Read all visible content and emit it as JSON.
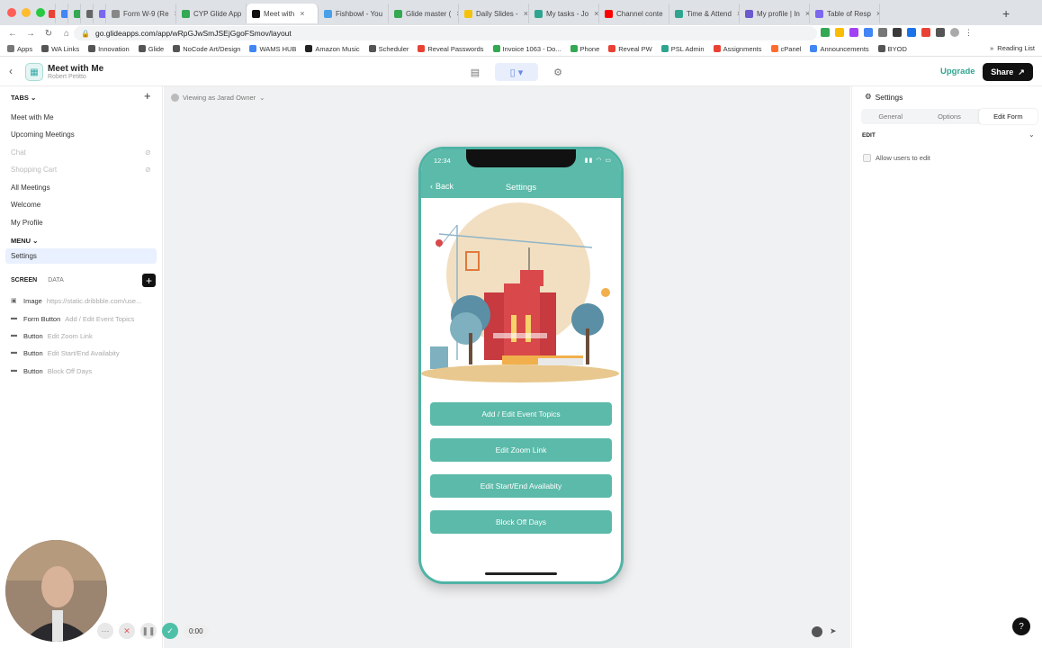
{
  "browser": {
    "tabs": [
      {
        "label": "",
        "color": "#e94235"
      },
      {
        "label": "",
        "color": "#4285f4"
      },
      {
        "label": "",
        "color": "#34a853"
      },
      {
        "label": "",
        "color": "#666666"
      },
      {
        "label": "",
        "color": "#7b68ee"
      },
      {
        "label": "Form W-9 (Re",
        "color": "#888888"
      },
      {
        "label": "CYP Glide App",
        "color": "#34a853"
      },
      {
        "label": "Meet with",
        "color": "#111111",
        "active": true
      },
      {
        "label": "Fishbowl - You",
        "color": "#4a9fe8"
      },
      {
        "label": "Glide master (",
        "color": "#34a853"
      },
      {
        "label": "Daily Slides -",
        "color": "#f4c20d"
      },
      {
        "label": "My tasks - Jo",
        "color": "#2fa58f"
      },
      {
        "label": "Channel conte",
        "color": "#ff0000"
      },
      {
        "label": "Time & Attend",
        "color": "#2fa58f"
      },
      {
        "label": "My profile | In",
        "color": "#6a5acd"
      },
      {
        "label": "Table of Resp",
        "color": "#7b68ee"
      }
    ],
    "url": "go.glideapps.com/app/wRpGJwSmJSEjGgoFSmov/layout",
    "bookmarks": [
      {
        "label": "Apps",
        "color": "#777777"
      },
      {
        "label": "WA Links",
        "color": "#555555"
      },
      {
        "label": "Innovation",
        "color": "#555555"
      },
      {
        "label": "Glide",
        "color": "#555555"
      },
      {
        "label": "NoCode Art/Design",
        "color": "#555555"
      },
      {
        "label": "WAMS HUB",
        "color": "#4285f4"
      },
      {
        "label": "Amazon Music",
        "color": "#222222"
      },
      {
        "label": "Scheduler",
        "color": "#555555"
      },
      {
        "label": "Reveal Passwords",
        "color": "#e94235"
      },
      {
        "label": "Invoice 1063 - Do...",
        "color": "#34a853"
      },
      {
        "label": "Phone",
        "color": "#34a853"
      },
      {
        "label": "Reveal PW",
        "color": "#e94235"
      },
      {
        "label": "PSL Admin",
        "color": "#2fa58f"
      },
      {
        "label": "Assignments",
        "color": "#e94235"
      },
      {
        "label": "cPanel",
        "color": "#ff6c2c"
      },
      {
        "label": "Announcements",
        "color": "#4285f4"
      },
      {
        "label": "BYOD",
        "color": "#555555"
      }
    ],
    "reading_list": "Reading List"
  },
  "app": {
    "title": "Meet with Me",
    "subtitle": "Robert Petitto",
    "upgrade_label": "Upgrade",
    "share_label": "Share"
  },
  "sidebar": {
    "tabs_heading": "TABS",
    "tabs": [
      {
        "label": "Meet with Me",
        "dim": false
      },
      {
        "label": "Upcoming Meetings",
        "dim": false
      },
      {
        "label": "Chat",
        "dim": true
      },
      {
        "label": "Shopping Cart",
        "dim": true
      }
    ],
    "more_tabs": [
      "All Meetings",
      "Welcome",
      "My Profile"
    ],
    "menu_heading": "MENU",
    "menu_items": [
      "Settings"
    ],
    "screen_tab": "SCREEN",
    "data_tab": "DATA",
    "components": [
      {
        "type": "Image",
        "value": "https://static.dribbble.com/use..."
      },
      {
        "type": "Form Button",
        "value": "Add / Edit Event Topics"
      },
      {
        "type": "Button",
        "value": "Edit Zoom Link"
      },
      {
        "type": "Button",
        "value": "Edit Start/End Availabity"
      },
      {
        "type": "Button",
        "value": "Block Off Days"
      }
    ]
  },
  "canvas": {
    "viewing_as": "Viewing as Jarad Owner"
  },
  "phone": {
    "time": "12:34",
    "back_label": "Back",
    "title": "Settings",
    "buttons": [
      "Add / Edit Event Topics",
      "Edit Zoom Link",
      "Edit Start/End Availabity",
      "Block Off Days"
    ]
  },
  "rightpanel": {
    "title": "Settings",
    "tabs": [
      "General",
      "Options",
      "Edit Form"
    ],
    "active_tab": "Edit Form",
    "section": "EDIT",
    "allow_edit_label": "Allow users to edit"
  },
  "recorder": {
    "time": "0:00"
  },
  "colors": {
    "accent": "#5bbaa9",
    "share_bg": "#111111",
    "upgrade": "#2fa58f"
  }
}
